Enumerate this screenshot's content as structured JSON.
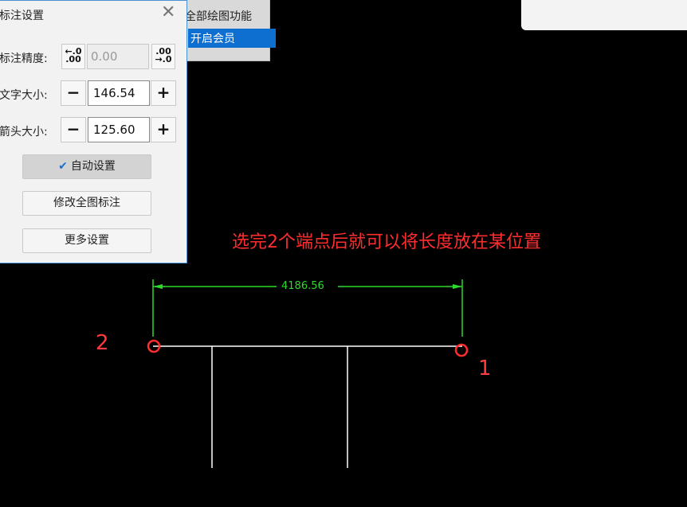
{
  "dialog": {
    "title": "标注设置",
    "close_icon": "close-icon",
    "precision": {
      "label": "标注精度:",
      "dec_icon": "←.0\n.00",
      "value": "0.00",
      "inc_icon": ".00\n→.0"
    },
    "text_size": {
      "label": "文字大小:",
      "minus": "−",
      "value": "146.54",
      "plus": "+"
    },
    "arrow_size": {
      "label": "箭头大小:",
      "minus": "−",
      "value": "125.60",
      "plus": "+"
    },
    "auto_setting": {
      "label": "自动设置",
      "checked": true
    },
    "modify_all": "修改全图标注",
    "more_settings": "更多设置"
  },
  "vip": {
    "title": "全部绘图功能",
    "button": "开启会员"
  },
  "canvas": {
    "hint": "选完2个端点后就可以将长度放在某位置",
    "dimension_value": "4186.56",
    "point_labels": [
      "2",
      "1"
    ],
    "colors": {
      "hint": "#ff2d2d",
      "dimension": "#2ed92e",
      "line": "#ffffff",
      "point": "#ff3b3b"
    }
  }
}
